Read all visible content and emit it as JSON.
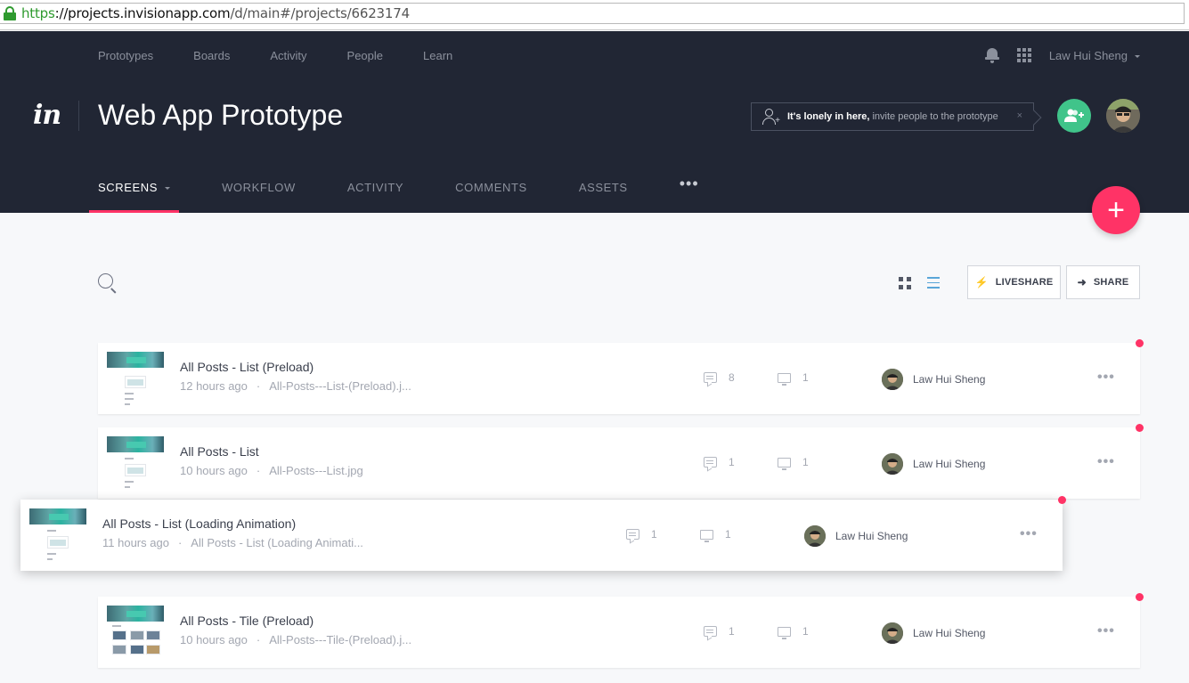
{
  "browser": {
    "url_scheme": "https",
    "url_host": "://projects.invisionapp.com",
    "url_path": "/d/main#/projects/6623174"
  },
  "topnav": {
    "items": [
      "Prototypes",
      "Boards",
      "Activity",
      "People",
      "Learn"
    ],
    "user_name": "Law Hui Sheng"
  },
  "project": {
    "logo_text": "in",
    "title": "Web App Prototype",
    "invite_bold": "It's lonely in here,",
    "invite_text": "invite people to the prototype",
    "invite_close": "×"
  },
  "tabs": [
    {
      "label": "SCREENS",
      "active": true
    },
    {
      "label": "WORKFLOW"
    },
    {
      "label": "ACTIVITY"
    },
    {
      "label": "COMMENTS"
    },
    {
      "label": "ASSETS"
    },
    {
      "label": "•••"
    }
  ],
  "fab": {
    "label": "+"
  },
  "toolbar": {
    "liveshare_label": "LIVESHARE",
    "share_label": "SHARE"
  },
  "screens": [
    {
      "title": "All Posts - List (Preload)",
      "time": "12 hours ago",
      "file": "All-Posts---List-(Preload).j...",
      "comments": "8",
      "devices": "1",
      "owner": "Law Hui Sheng",
      "more": "•••"
    },
    {
      "title": "All Posts - List",
      "time": "10 hours ago",
      "file": "All-Posts---List.jpg",
      "comments": "1",
      "devices": "1",
      "owner": "Law Hui Sheng",
      "more": "•••"
    },
    {
      "title": "All Posts - List (Loading Animation)",
      "time": "11 hours ago",
      "file": "All Posts - List (Loading Animati...",
      "comments": "1",
      "devices": "1",
      "owner": "Law Hui Sheng",
      "more": "•••"
    },
    {
      "title": "All Posts - Tile (Preload)",
      "time": "10 hours ago",
      "file": "All-Posts---Tile-(Preload).j...",
      "comments": "1",
      "devices": "1",
      "owner": "Law Hui Sheng",
      "more": "•••"
    }
  ],
  "colors": {
    "header_bg": "#212634",
    "accent": "#ff3366",
    "add_people": "#40c48a"
  }
}
